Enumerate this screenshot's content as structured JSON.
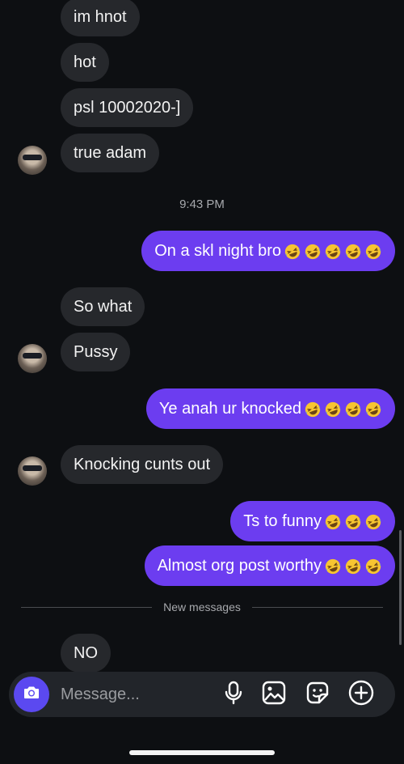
{
  "messages": {
    "in1": "im hnot",
    "in2": "hot",
    "in3": "psl 10002020-]",
    "in4": "true adam",
    "time": "9:43 PM",
    "out1": "On a skl night bro",
    "in5": "So what",
    "in6": "Pussy",
    "out2": "Ye anah ur knocked",
    "in7": "Knocking cunts out",
    "out3": "Ts to funny",
    "out4": "Almost org post worthy",
    "divider": "New messages",
    "in8": "NO"
  },
  "composer": {
    "placeholder": "Message..."
  },
  "icons": {
    "emoji": "rolling-on-floor-laughing",
    "camera": "camera-icon",
    "mic": "microphone-icon",
    "gallery": "gallery-icon",
    "sticker": "sticker-icon",
    "plus": "plus-icon"
  },
  "colors": {
    "outgoing": "#6c3df0",
    "incoming": "#26282c",
    "background": "#0d0f12"
  }
}
